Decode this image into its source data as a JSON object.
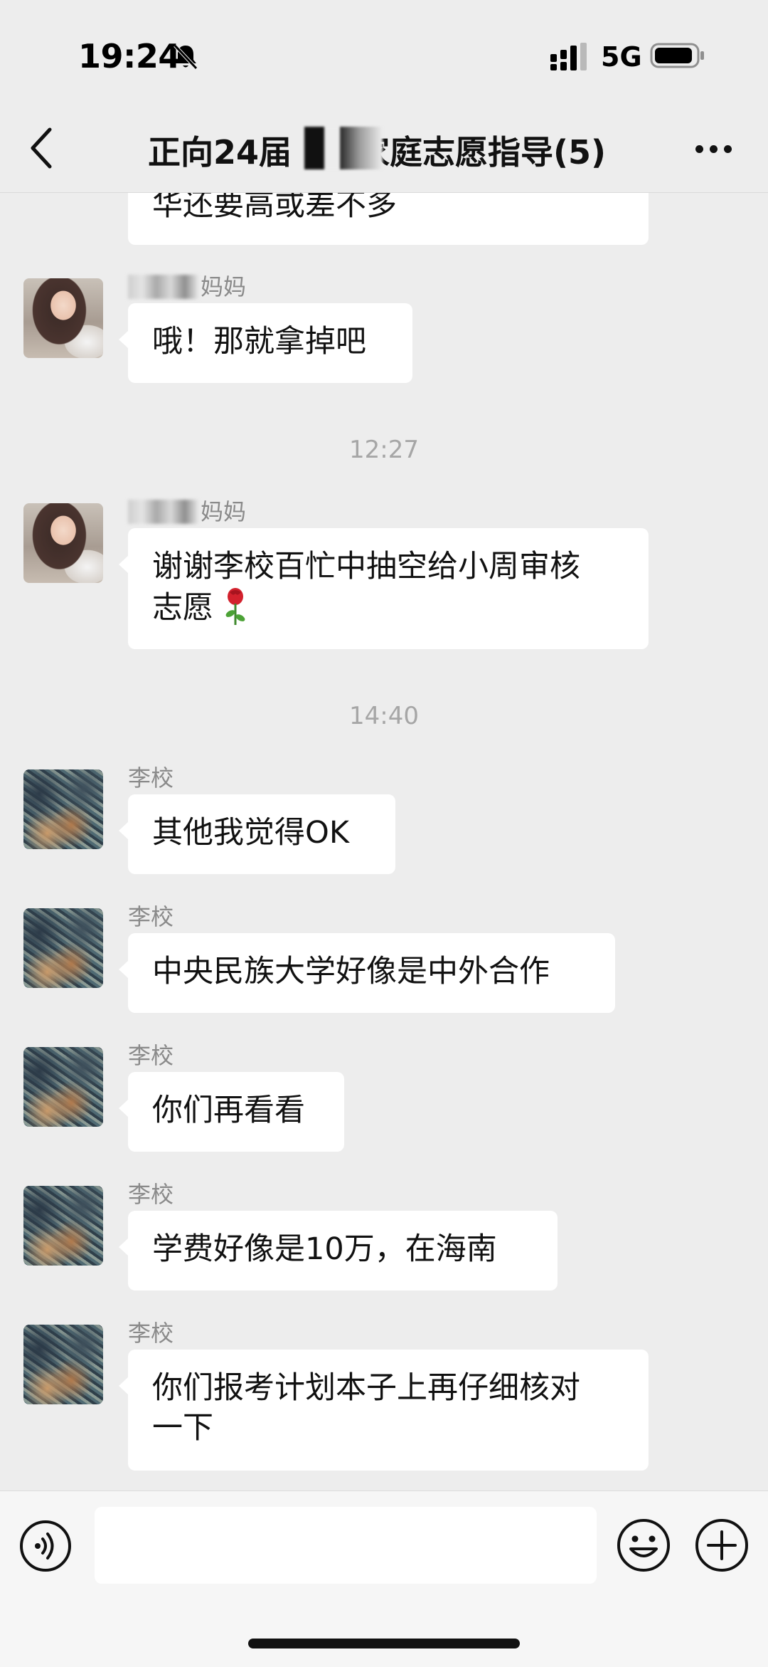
{
  "status_bar": {
    "time": "19:24",
    "network": "5G",
    "icons": [
      "bell-muted-icon",
      "signal-icon",
      "battery-icon"
    ]
  },
  "header": {
    "title": "正向24届　　家庭志愿指导(5)",
    "back_icon": "chevron-left-icon",
    "more_icon": "more-dots-icon"
  },
  "messages": {
    "m0": {
      "text": "华还要高或差不多"
    },
    "m1": {
      "sender": "妈妈",
      "text": "哦！那就拿掉吧"
    },
    "t1": "12:27",
    "m2": {
      "sender": "妈妈",
      "text_line1": "谢谢李校百忙中抽空给小周审核",
      "text_line2": "志愿",
      "emoji": "rose"
    },
    "t2": "14:40",
    "m3": {
      "sender": "李校",
      "text": "其他我觉得OK"
    },
    "m4": {
      "sender": "李校",
      "text": "中央民族大学好像是中外合作"
    },
    "m5": {
      "sender": "李校",
      "text": "你们再看看"
    },
    "m6": {
      "sender": "李校",
      "text": "学费好像是10万，在海南"
    },
    "m7": {
      "sender": "李校",
      "text_line1": "你们报考计划本子上再仔细核对",
      "text_line2": "一下"
    }
  },
  "input_bar": {
    "placeholder": "",
    "value": "",
    "icons": [
      "voice-icon",
      "emoji-icon",
      "plus-icon"
    ]
  },
  "colors": {
    "background": "#ededed",
    "bubble": "#ffffff",
    "meta_text": "#8a8a8a"
  }
}
